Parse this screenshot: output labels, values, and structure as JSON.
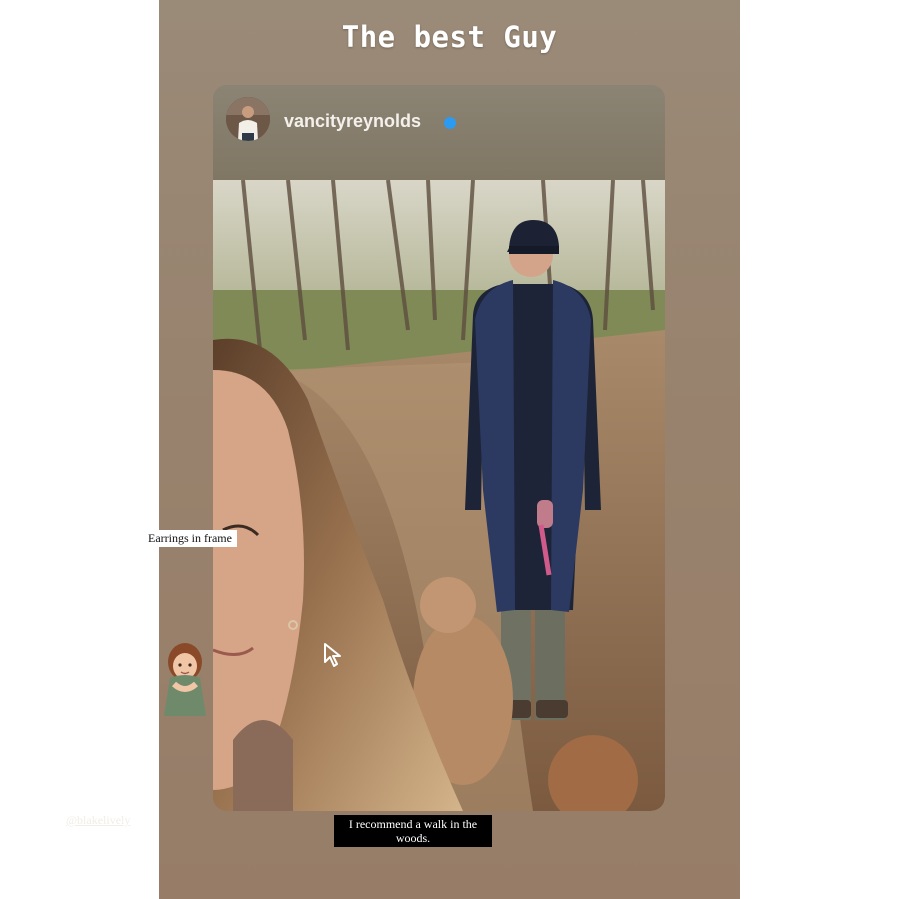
{
  "story": {
    "title": "The best Guy",
    "background_color": "#98836e"
  },
  "post": {
    "username": "vancityreynolds",
    "verified": true,
    "verified_color": "#2a9bf0",
    "photo_icon": "forest-walk-photo",
    "avatar_icon": "profile-avatar"
  },
  "stickers": {
    "earrings": "Earrings in frame",
    "mention": "@blakelively",
    "caption": "I recommend a walk in the woods.",
    "cursor_icon": "cursor-arrow-icon",
    "character_icon": "cartoon-girl-sticker"
  }
}
